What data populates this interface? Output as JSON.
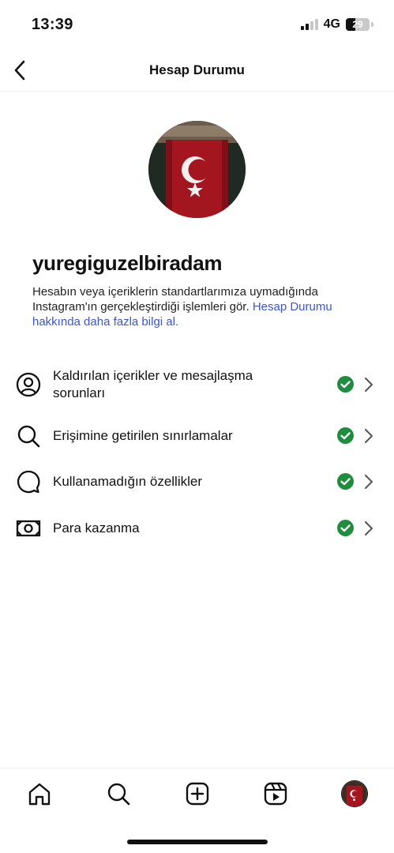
{
  "status_bar": {
    "time": "13:39",
    "network": "4G",
    "battery": "29",
    "battery_level": 0.29,
    "signal_bars_active": 2
  },
  "header": {
    "title": "Hesap Durumu",
    "back_icon": "chevron-left-icon"
  },
  "profile": {
    "avatar_icon": "turkish-flag-avatar",
    "username": "yuregiguzelbiradam",
    "description": "Hesabın veya içeriklerin standartlarımıza uymadığında Instagram'ın gerçekleştirdiği işlemleri gör.",
    "link_text": "Hesap Durumu hakkında daha fazla bilgi al."
  },
  "status_items": [
    {
      "label": "Kaldırılan içerikler ve mesajlaşma sorunları",
      "icon": "user-circle-icon",
      "status": "ok"
    },
    {
      "label": "Erişimine getirilen sınırlamalar",
      "icon": "search-icon",
      "status": "ok"
    },
    {
      "label": "Kullanamadığın özellikler",
      "icon": "chat-bubble-icon",
      "status": "ok"
    },
    {
      "label": "Para kazanma",
      "icon": "money-icon",
      "status": "ok"
    }
  ],
  "colors": {
    "accent_link": "#3b55d6",
    "ok_green": "#1e8e3e",
    "flag_red": "#a3161f"
  },
  "bottom_nav": [
    "home-icon",
    "search-icon",
    "create-plus-icon",
    "reels-icon",
    "profile-avatar"
  ]
}
